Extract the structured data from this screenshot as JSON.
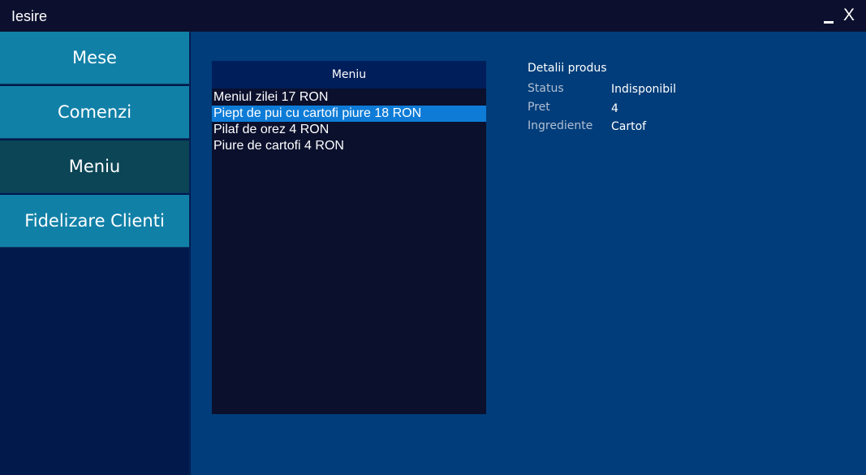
{
  "window": {
    "title": "Iesire",
    "minimize_icon": "minimize-icon",
    "close_label": "X"
  },
  "sidebar": {
    "items": [
      {
        "label": "Mese",
        "active": false
      },
      {
        "label": "Comenzi",
        "active": false
      },
      {
        "label": "Meniu",
        "active": true
      },
      {
        "label": "Fidelizare Clienti",
        "active": false
      }
    ]
  },
  "menu_list": {
    "header": "Meniu",
    "items": [
      {
        "label": "Meniul zilei   17 RON",
        "selected": false
      },
      {
        "label": "Piept de pui cu cartofi piure   18 RON",
        "selected": true
      },
      {
        "label": "Pilaf de orez   4 RON",
        "selected": false
      },
      {
        "label": "Piure de cartofi   4 RON",
        "selected": false
      }
    ]
  },
  "details": {
    "title": "Detalii produs",
    "fields": [
      {
        "label": "Status",
        "value": "Indisponibil"
      },
      {
        "label": "Pret",
        "value": "4"
      },
      {
        "label": "Ingrediente",
        "value": "Cartof"
      }
    ]
  },
  "colors": {
    "title_bar": "#0c102e",
    "nav_button": "#1180a7",
    "nav_button_active": "#0b4556",
    "main_background": "#003d7a",
    "list_background": "#0b102d",
    "selection": "#0e7cd7"
  }
}
